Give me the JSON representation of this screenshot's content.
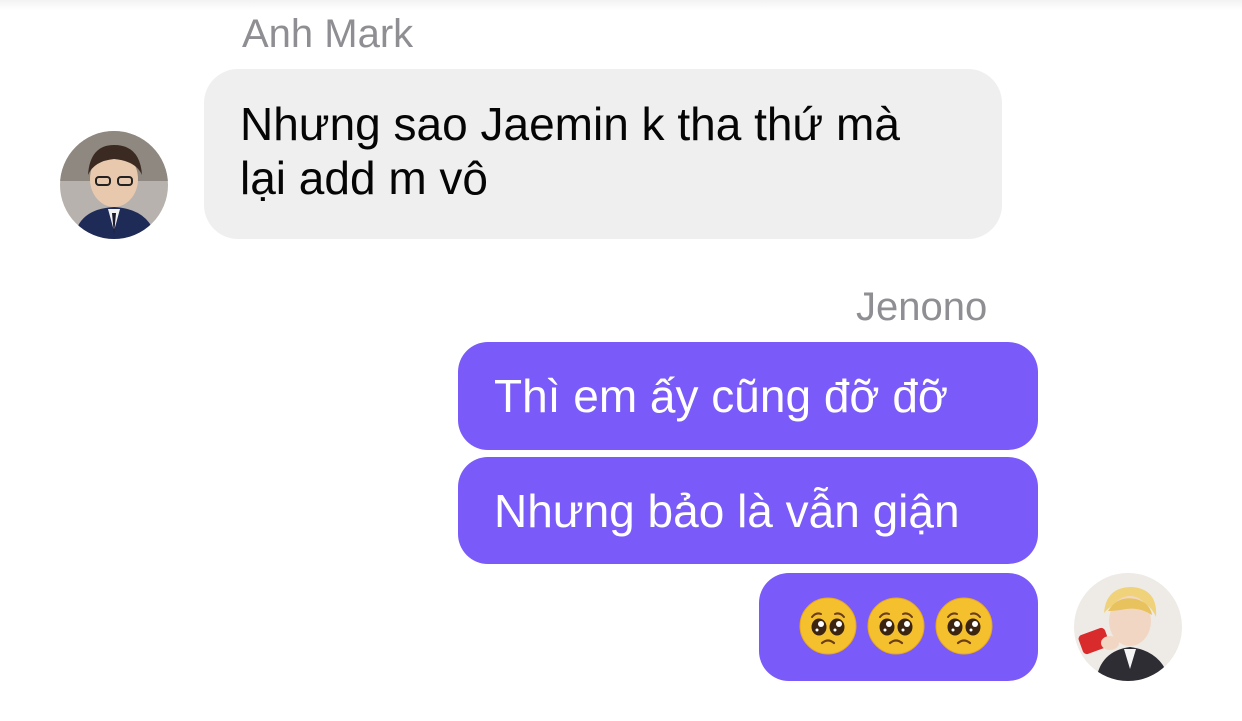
{
  "conversation": {
    "incoming": {
      "sender": "Anh Mark",
      "lines": [
        "Nhưng sao Jaemin k tha thứ mà",
        "lại add m vô"
      ],
      "avatar_icon": "person-photo-avatar"
    },
    "outgoing": {
      "sender": "Jenono",
      "messages": [
        "Thì em ấy cũng đỡ đỡ",
        "Nhưng bảo là vẫn giận"
      ],
      "emoji_message": [
        "🥺",
        "🥺",
        "🥺"
      ],
      "emoji_name": "pleading-face-icon",
      "avatar_icon": "person-photo-avatar"
    }
  },
  "colors": {
    "incoming_bubble": "#efefef",
    "outgoing_bubble": "#7a5af8",
    "sender_name": "#8e8e93"
  }
}
